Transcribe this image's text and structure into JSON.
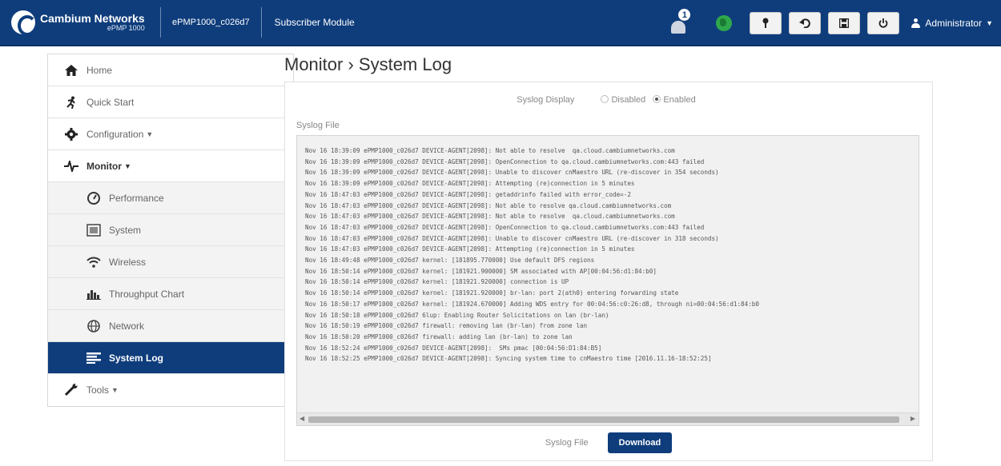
{
  "header": {
    "brand": "Cambium Networks",
    "model": "ePMP 1000",
    "device_name": "ePMP1000_c026d7",
    "mode": "Subscriber Module",
    "alert_count": "1",
    "user": "Administrator"
  },
  "sidebar": {
    "items": [
      {
        "label": "Home"
      },
      {
        "label": "Quick Start"
      },
      {
        "label": "Configuration"
      },
      {
        "label": "Monitor"
      },
      {
        "label": "Performance"
      },
      {
        "label": "System"
      },
      {
        "label": "Wireless"
      },
      {
        "label": "Throughput Chart"
      },
      {
        "label": "Network"
      },
      {
        "label": "System Log"
      },
      {
        "label": "Tools"
      }
    ]
  },
  "page": {
    "title": "Monitor › System Log",
    "syslog_display_label": "Syslog Display",
    "opt_disabled": "Disabled",
    "opt_enabled": "Enabled",
    "syslog_file_label": "Syslog File",
    "download_label": "Syslog File",
    "download_button": "Download"
  },
  "log": {
    "lines": [
      "Nov 16 18:39:09 ePMP1000_c026d7 DEVICE-AGENT[2098]: Not able to resolve  qa.cloud.cambiumnetworks.com",
      "Nov 16 18:39:09 ePMP1000_c026d7 DEVICE-AGENT[2098]: OpenConnection to qa.cloud.cambiumnetworks.com:443 failed",
      "Nov 16 18:39:09 ePMP1000_c026d7 DEVICE-AGENT[2098]: Unable to discover cnMaestro URL (re-discover in 354 seconds)",
      "Nov 16 18:39:09 ePMP1000_c026d7 DEVICE-AGENT[2098]: Attempting (re)connection in 5 minutes",
      "Nov 16 18:47:03 ePMP1000_c026d7 DEVICE-AGENT[2098]: getaddrinfo failed with error_code=-2",
      "Nov 16 18:47:03 ePMP1000_c026d7 DEVICE-AGENT[2098]: Not able to resolve qa.cloud.cambiumnetworks.com",
      "Nov 16 18:47:03 ePMP1000_c026d7 DEVICE-AGENT[2098]: Not able to resolve  qa.cloud.cambiumnetworks.com",
      "Nov 16 18:47:03 ePMP1000_c026d7 DEVICE-AGENT[2098]: OpenConnection to qa.cloud.cambiumnetworks.com:443 failed",
      "Nov 16 18:47:03 ePMP1000_c026d7 DEVICE-AGENT[2098]: Unable to discover cnMaestro URL (re-discover in 318 seconds)",
      "Nov 16 18:47:03 ePMP1000_c026d7 DEVICE-AGENT[2098]: Attempting (re)connection in 5 minutes",
      "Nov 16 18:49:48 ePMP1000_c026d7 kernel: [181895.770000] Use default DFS regions",
      "Nov 16 18:50:14 ePMP1000_c026d7 kernel: [181921.900000] SM associated with AP[00:04:56:d1:84:b0]",
      "Nov 16 18:50:14 ePMP1000_c026d7 kernel: [181921.920000] connection is UP",
      "Nov 16 18:50:14 ePMP1000_c026d7 kernel: [181921.920000] br-lan: port 2(ath0) entering forwarding state",
      "Nov 16 18:50:17 ePMP1000_c026d7 kernel: [181924.670000] Adding WDS entry for 00:04:56:c0:26:d8, through ni=00:04:56:d1:84:b0",
      "Nov 16 18:50:18 ePMP1000_c026d7 6lup: Enabling Router Solicitations on lan (br-lan)",
      "Nov 16 18:50:19 ePMP1000_c026d7 firewall: removing lan (br-lan) from zone lan",
      "Nov 16 18:50:20 ePMP1000_c026d7 firewall: adding lan (br-lan) to zone lan",
      "Nov 16 18:52:24 ePMP1000_c026d7 DEVICE-AGENT[2098]:  SMs pmac [00:04:56:D1:84:B5]",
      "Nov 16 18:52:25 ePMP1000_c026d7 DEVICE-AGENT[2098]: Syncing system time to cnMaestro time [2016.11.16-18:52:25]"
    ]
  },
  "colors": {
    "header_bg": "#0f3d7c",
    "active_nav_bg": "#0f3d7c",
    "button_primary": "#0f3d7c",
    "status_globe": "#2ea84b"
  },
  "icons": {
    "logo": "cambium-logo-icon",
    "alert": "bell-icon",
    "status": "globe-icon",
    "tool_buttons": [
      "pin-icon",
      "undo-icon",
      "save-icon",
      "power-icon"
    ],
    "user": "user-icon"
  }
}
